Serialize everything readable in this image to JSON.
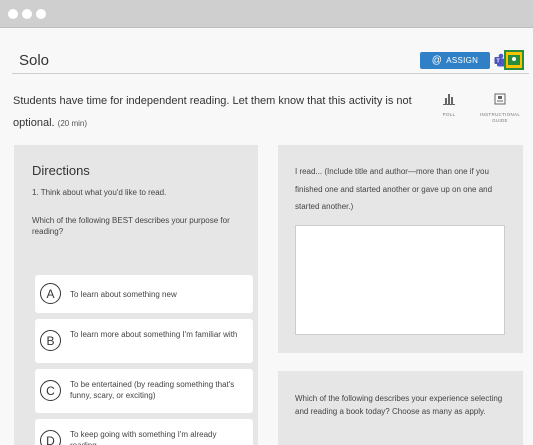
{
  "window": {
    "controls": [
      "close",
      "minimize",
      "maximize"
    ]
  },
  "header": {
    "title": "Solo",
    "assign_label": "ASSIGN",
    "assign_icon": "at-icon",
    "accent_color": "#2f80c6"
  },
  "activity": {
    "description": "Students have time for independent reading. Let them know that this activity is not optional.",
    "duration": "(20 min)"
  },
  "tools": {
    "poll_label": "POLL",
    "guide_label": "INSTRUCTIONAL GUIDE"
  },
  "directions": {
    "title": "Directions",
    "step": "1. Think about what you'd like to read.",
    "question": "Which of the following BEST describes your purpose for reading?",
    "options": [
      {
        "letter": "A",
        "text": "To learn about something new"
      },
      {
        "letter": "B",
        "text": "To learn more about something I'm familiar with"
      },
      {
        "letter": "C",
        "text": "To be entertained (by reading something that's funny, scary, or exciting)"
      },
      {
        "letter": "D",
        "text": "To keep going with something I'm already reading"
      }
    ]
  },
  "reading_log": {
    "prompt": "I read... (Include title and author—more than one if you finished one and started another or gave up on one and started another.)",
    "answer": ""
  },
  "experience": {
    "prompt": "Which of the following describes your experience selecting and reading a book today? Choose as many as apply."
  }
}
